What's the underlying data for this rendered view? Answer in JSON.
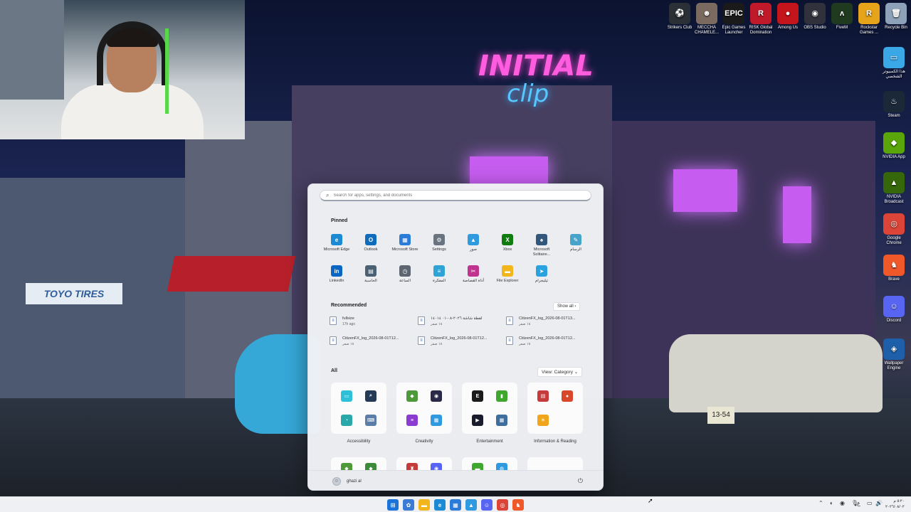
{
  "desktop_icons": [
    {
      "label": "Strikers Club",
      "icon": "strikers-club-icon",
      "glyph": "⚽",
      "color": "#2b2f36"
    },
    {
      "label": "MECCHA CHAMELE...",
      "icon": "meccha-chameleon-icon",
      "glyph": "☻",
      "color": "#7a6a60"
    },
    {
      "label": "Epic Games Launcher",
      "icon": "epic-games-icon",
      "glyph": "EPIC",
      "color": "#1a1a1a"
    },
    {
      "label": "RISK Global Domination",
      "icon": "risk-icon",
      "glyph": "R",
      "color": "#c01a2a"
    },
    {
      "label": "Among Us",
      "icon": "among-us-icon",
      "glyph": "●",
      "color": "#c4141c"
    },
    {
      "label": "OBS Studio",
      "icon": "obs-icon",
      "glyph": "◉",
      "color": "#30313a"
    },
    {
      "label": "FiveM",
      "icon": "fivem-icon",
      "glyph": "ʌ",
      "color": "#1f3a1f"
    },
    {
      "label": "Rockstar Games ...",
      "icon": "rockstar-icon",
      "glyph": "R",
      "color": "#e6a41a"
    },
    {
      "label": "Recycle Bin",
      "icon": "recycle-bin-icon",
      "glyph": "🗑",
      "color": "#8da2b8"
    }
  ],
  "desktop_icons_right": [
    {
      "label": "هذا الكمبيوتر الشخصي",
      "icon": "this-pc-icon",
      "glyph": "▭",
      "color": "#3aa7e6"
    },
    {
      "label": "Steam",
      "icon": "steam-icon",
      "glyph": "♨",
      "color": "#1b2838"
    },
    {
      "label": "NVIDIA App",
      "icon": "nvidia-app-icon",
      "glyph": "◆",
      "color": "#5aa60a"
    },
    {
      "label": "NVIDIA Broadcast",
      "icon": "nvidia-broadcast-icon",
      "glyph": "▲",
      "color": "#36670a"
    },
    {
      "label": "Google Chrome",
      "icon": "chrome-icon",
      "glyph": "◎",
      "color": "#db4437"
    },
    {
      "label": "Brave",
      "icon": "brave-icon",
      "glyph": "♞",
      "color": "#f0582a"
    },
    {
      "label": "Discord",
      "icon": "discord-icon",
      "glyph": "☺",
      "color": "#5865f2"
    },
    {
      "label": "Wallpaper Engine",
      "icon": "wallpaper-engine-icon",
      "glyph": "◈",
      "color": "#1d5fa8"
    }
  ],
  "wallpaper": {
    "neon_sign_1": "INITIAL",
    "neon_sign_2": "clip",
    "shop_sign": "TOYO TIRES",
    "plate": "13-54"
  },
  "start_menu": {
    "search_placeholder": "Search for apps, settings, and documents",
    "pinned_title": "Pinned",
    "pinned": [
      {
        "label": "Microsoft Edge",
        "icon": "edge-icon",
        "glyph": "e",
        "color": "#1a8ad4"
      },
      {
        "label": "Outlook",
        "icon": "outlook-icon",
        "glyph": "O",
        "color": "#0f6cbd"
      },
      {
        "label": "Microsoft Store",
        "icon": "store-icon",
        "glyph": "▦",
        "color": "#2b7bd8"
      },
      {
        "label": "Settings",
        "icon": "settings-icon",
        "glyph": "⚙",
        "color": "#6a7480"
      },
      {
        "label": "صور",
        "icon": "photos-icon",
        "glyph": "▲",
        "color": "#2f9ae0"
      },
      {
        "label": "Xbox",
        "icon": "xbox-icon",
        "glyph": "X",
        "color": "#107c10"
      },
      {
        "label": "Microsoft Solitaire...",
        "icon": "solitaire-icon",
        "glyph": "♠",
        "color": "#31577c"
      },
      {
        "label": "الرسام",
        "icon": "paint-icon",
        "glyph": "✎",
        "color": "#46a3c9"
      },
      {
        "label": "LinkedIn",
        "icon": "linkedin-icon",
        "glyph": "in",
        "color": "#0a66c2"
      },
      {
        "label": "الحاسبة",
        "icon": "calculator-icon",
        "glyph": "▤",
        "color": "#4a6073"
      },
      {
        "label": "الساعة",
        "icon": "clock-icon",
        "glyph": "◷",
        "color": "#5d6670"
      },
      {
        "label": "المفكرة",
        "icon": "notepad-icon",
        "glyph": "≡",
        "color": "#2da3d6"
      },
      {
        "label": "أداة القصاصة",
        "icon": "snipping-tool-icon",
        "glyph": "✂",
        "color": "#c0338f"
      },
      {
        "label": "File Explorer",
        "icon": "file-explorer-icon",
        "glyph": "▬",
        "color": "#f2b51c"
      },
      {
        "label": "تيليجرام",
        "icon": "telegram-icon",
        "glyph": "➤",
        "color": "#2aa2e0"
      }
    ],
    "recommended_title": "Recommended",
    "show_all": "Show all ›",
    "recommended": [
      {
        "name": "fullsize",
        "time": "17h ago"
      },
      {
        "name": "لقطة شاشة ٢٠٢٦-٠٨-٠١ ١٤٠١٤",
        "time": "١٨ صفر"
      },
      {
        "name": "CitizenFX_log_2026-08-01T13...",
        "time": "١٨ صفر"
      },
      {
        "name": "CitizenFX_log_2026-08-01T12...",
        "time": "١٨ صفر"
      },
      {
        "name": "CitizenFX_log_2026-08-01T12...",
        "time": "١٨ صفر"
      },
      {
        "name": "CitizenFX_log_2026-08-01T12...",
        "time": "١٨ صفر"
      }
    ],
    "all_title": "All",
    "view_category": "View: Category ⌄",
    "categories": [
      {
        "label": "Accessibility",
        "icons": [
          {
            "name": "magnifier-icon",
            "glyph": "▭",
            "color": "#2ec0d8"
          },
          {
            "name": "narrator-icon",
            "glyph": "⌕",
            "color": "#243a56"
          },
          {
            "name": "voice-access-icon",
            "glyph": "◔",
            "color": "#2aa7a8"
          },
          {
            "name": "onscreen-keyboard-icon",
            "glyph": "⌨",
            "color": "#5a7ea8"
          }
        ]
      },
      {
        "label": "Creativity",
        "icons": [
          {
            "name": "clipchamp-icon",
            "glyph": "◆",
            "color": "#4e9a3a"
          },
          {
            "name": "obs-app-icon",
            "glyph": "◉",
            "color": "#2a2a48"
          },
          {
            "name": "stacked-app-icon",
            "glyph": "≡",
            "color": "#8c3bd1"
          },
          {
            "name": "photos-app-icon",
            "glyph": "▦",
            "color": "#2f9ae0"
          }
        ]
      },
      {
        "label": "Entertainment",
        "icons": [
          {
            "name": "epic-app-icon",
            "glyph": "E",
            "color": "#1a1a1a"
          },
          {
            "name": "game-bar-icon",
            "glyph": "▮",
            "color": "#3fa62e"
          },
          {
            "name": "media-player-icon",
            "glyph": "▶",
            "color": "#1b1b2e"
          },
          {
            "name": "games-collection-icon",
            "glyph": "▦",
            "color": "#3d6e9e"
          }
        ]
      },
      {
        "label": "Information & Reading",
        "icons": [
          {
            "name": "news-icon",
            "glyph": "▤",
            "color": "#c53b3b"
          },
          {
            "name": "maps-icon",
            "glyph": "●",
            "color": "#d9472a"
          },
          {
            "name": "weather-icon",
            "glyph": "☀",
            "color": "#f0a51a"
          }
        ]
      }
    ],
    "row2_icons": [
      {
        "name": "row2-app-1-icon",
        "glyph": "◆",
        "color": "#4e9a3a"
      },
      {
        "name": "row2-app-2-icon",
        "glyph": "◆",
        "color": "#3d8b3a"
      },
      {
        "name": "row2-app-3-icon",
        "glyph": "♜",
        "color": "#c53b3b"
      },
      {
        "name": "row2-app-4-icon",
        "glyph": "◉",
        "color": "#5865f2"
      },
      {
        "name": "row2-app-5-icon",
        "glyph": "▬",
        "color": "#3fa62e"
      },
      {
        "name": "row2-app-6-icon",
        "glyph": "◍",
        "color": "#2f9ae0"
      }
    ],
    "user_name": "ghazi al",
    "power_label": "⏻"
  },
  "taskbar": {
    "apps": [
      {
        "name": "start-button",
        "glyph": "⊞",
        "color": "#1a73d9"
      },
      {
        "name": "copilot-taskbar-icon",
        "glyph": "✿",
        "color": "#3a7bd5"
      },
      {
        "name": "file-explorer-taskbar-icon",
        "glyph": "▬",
        "color": "#f2b51c"
      },
      {
        "name": "edge-taskbar-icon",
        "glyph": "e",
        "color": "#1a8ad4"
      },
      {
        "name": "store-taskbar-icon",
        "glyph": "▦",
        "color": "#2b7bd8"
      },
      {
        "name": "photos-taskbar-icon",
        "glyph": "▲",
        "color": "#2f9ae0"
      },
      {
        "name": "discord-taskbar-icon",
        "glyph": "☺",
        "color": "#5865f2"
      },
      {
        "name": "chrome-taskbar-icon",
        "glyph": "◎",
        "color": "#db4437"
      },
      {
        "name": "brave-taskbar-icon",
        "glyph": "♞",
        "color": "#f0582a"
      }
    ],
    "tray": [
      "⌃",
      "◐",
      "◉",
      "🎙",
      "ع",
      "▭",
      "🔊",
      "▭"
    ],
    "time": "٥:٢٠ م",
    "date": "٢٠٢٦/٠٨/٠٢"
  }
}
